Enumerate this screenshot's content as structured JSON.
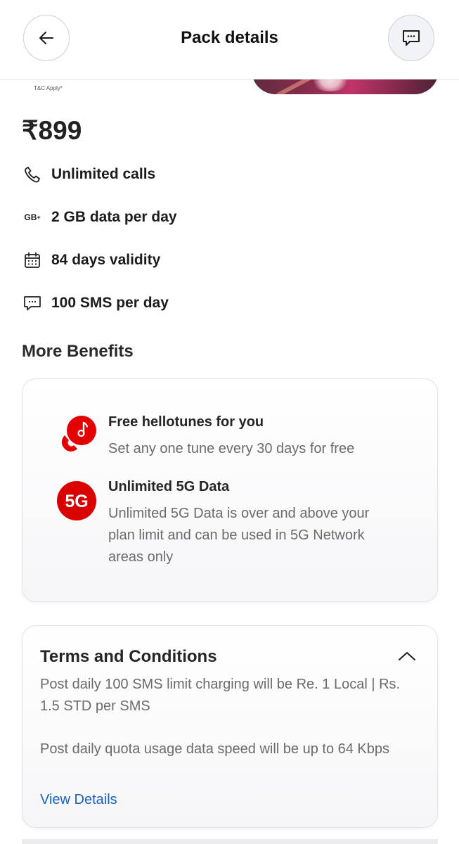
{
  "header": {
    "title": "Pack details",
    "back_icon": "arrow-left-icon",
    "chat_icon": "chat-bubble-icon"
  },
  "banner": {
    "tnc_text": "T&C Apply*"
  },
  "plan": {
    "price": "₹899",
    "features": [
      {
        "icon": "phone-icon",
        "label": "Unlimited calls"
      },
      {
        "icon": "gb-data-icon",
        "icon_text": "GB",
        "icon_sup": "+",
        "label": "2 GB data per day"
      },
      {
        "icon": "calendar-icon",
        "label": "84 days validity"
      },
      {
        "icon": "sms-icon",
        "label": "100 SMS per day"
      }
    ]
  },
  "benefits": {
    "title": "More Benefits",
    "items": [
      {
        "icon": "hellotunes-icon",
        "title": "Free hellotunes for you",
        "description": "Set any one tune every 30 days for free"
      },
      {
        "icon": "5g-icon",
        "icon_text": "5G",
        "title": "Unlimited 5G Data",
        "description": "Unlimited 5G Data is over and above your plan limit and can be used in 5G Network areas only"
      }
    ]
  },
  "terms": {
    "title": "Terms and Conditions",
    "paragraphs": [
      "Post daily 100 SMS limit charging will be Re. 1 Local | Rs. 1.5 STD per SMS",
      "Post daily quota usage data speed will be up to 64 Kbps"
    ],
    "link": "View Details"
  },
  "colors": {
    "brand_red": "#e40000",
    "link_blue": "#1a62c0"
  }
}
